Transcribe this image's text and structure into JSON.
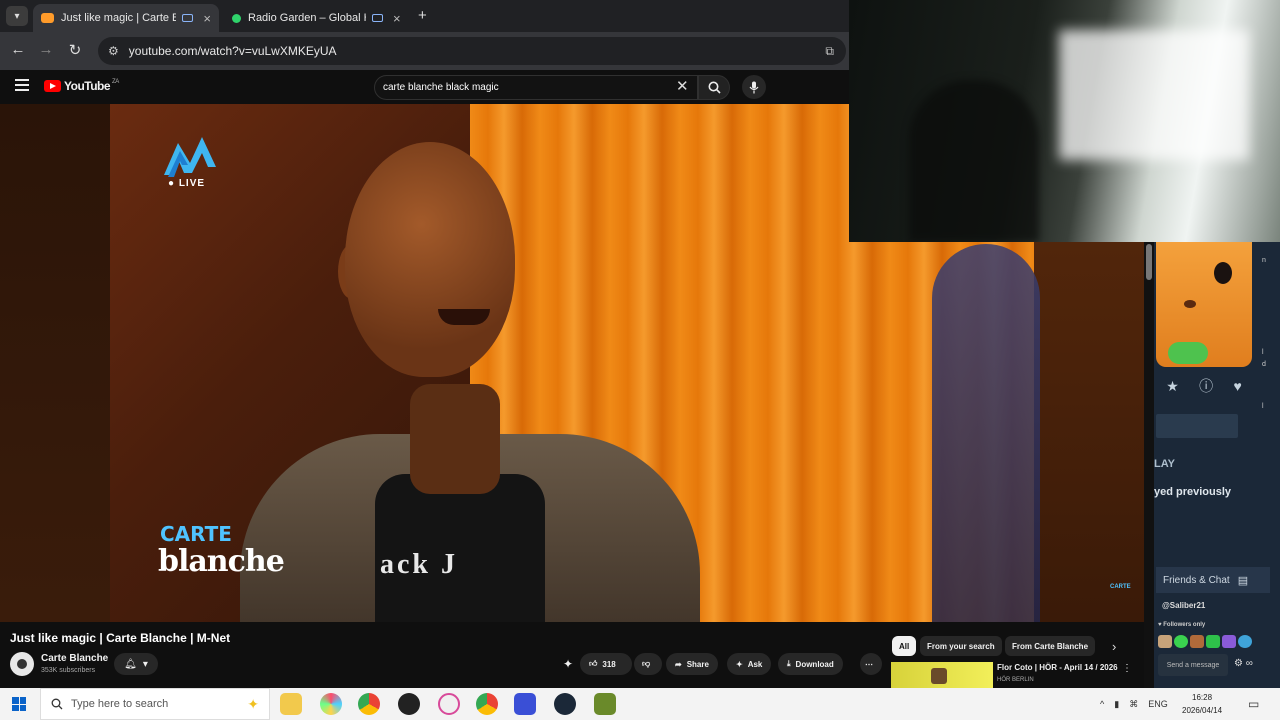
{
  "browser": {
    "tabs": [
      {
        "title": "Just like magic | Carte Blanc",
        "favicon_color": "#ff9b2a",
        "active": true
      },
      {
        "title": "Radio Garden – Global Han",
        "favicon_color": "#2fd36b",
        "active": false
      }
    ],
    "url": "youtube.com/watch?v=vuLwXMKEyUA"
  },
  "youtube": {
    "logo_text": "YouTube",
    "region": "ZA",
    "search_query": "carte blanche black magic"
  },
  "video": {
    "overlay_live": "LIVE",
    "overlay_carte": "CARTE",
    "overlay_blanche": "blanche",
    "overlay_small": "CARTE",
    "shirt_text": "ack J"
  },
  "info": {
    "title": "Just like magic | Carte Blanche | M-Net",
    "channel": "Carte Blanche",
    "subscribers": "353K subscribers",
    "likes": "318",
    "share": "Share",
    "ask": "Ask",
    "download": "Download"
  },
  "chips": [
    "All",
    "From your search",
    "From Carte Blanche"
  ],
  "recommendation": {
    "title": "Flor Coto | HÖR - April 14 / 2026",
    "channel": "HÖR BERLIN"
  },
  "stream_panel": {
    "play_label": "LAY",
    "played_label": "yed previously",
    "friends_chat": "Friends & Chat",
    "chat_user": "@Saliber21",
    "followers_only": "Followers only",
    "send_message": "Send a message",
    "edge_letters": [
      "n",
      "l",
      "d",
      "l"
    ]
  },
  "taskbar": {
    "search_placeholder": "Type here to search",
    "language": "ENG",
    "time": "16:28",
    "date": "2026/04/14"
  }
}
